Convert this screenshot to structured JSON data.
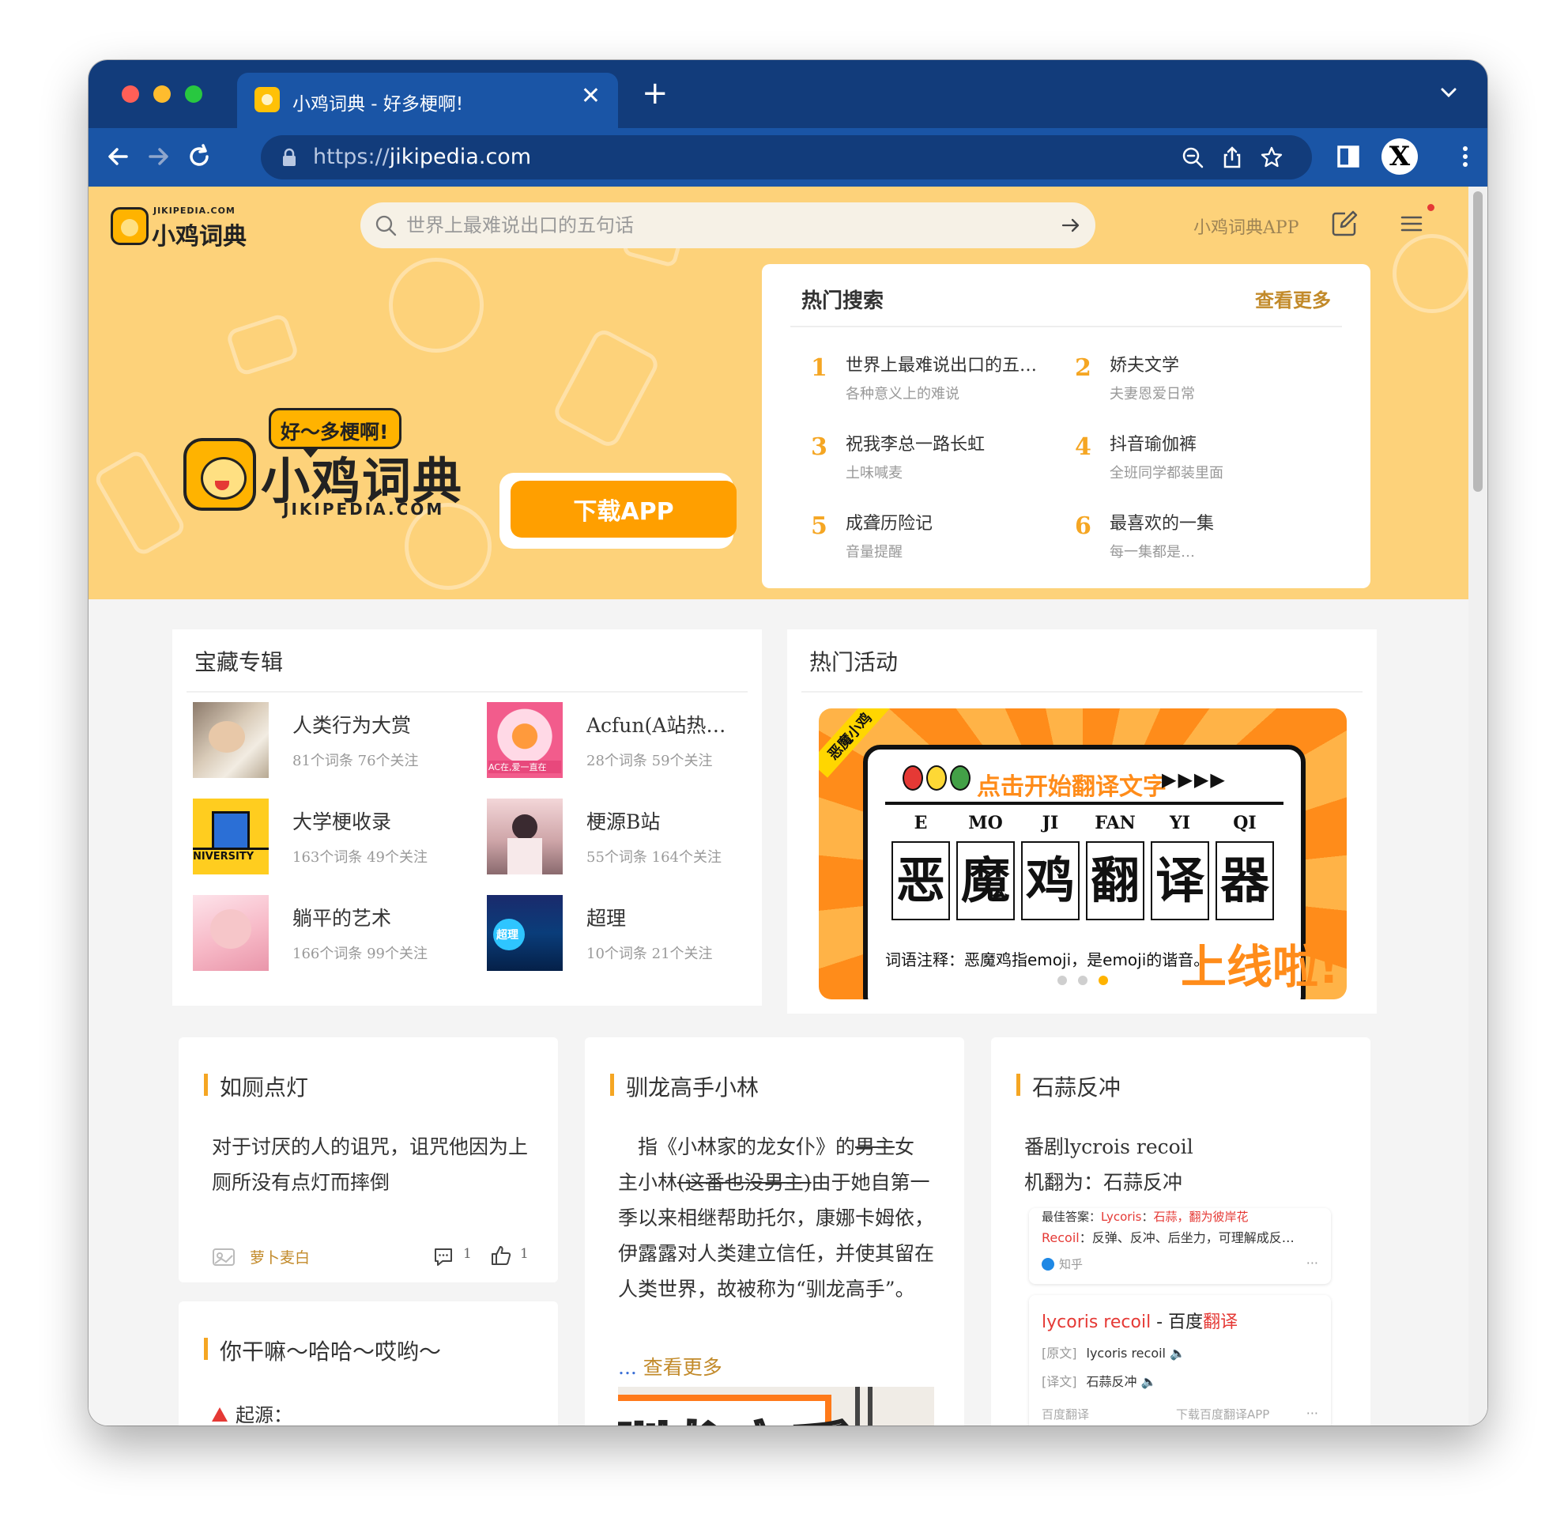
{
  "browser": {
    "tab_title": "小鸡词典 - 好多梗啊!",
    "url_scheme": "https://",
    "url_host": "jikipedia.com"
  },
  "header": {
    "logo_small": "JIKIPEDIA.COM",
    "logo_name": "小鸡词典",
    "search_placeholder": "世界上最难说出口的五句话",
    "app_link": "小鸡词典APP"
  },
  "hero": {
    "tagline": "好～多梗啊!",
    "brand_name": "小鸡词典",
    "brand_domain": "JIKIPEDIA.COM",
    "download_label": "下载APP"
  },
  "hot_search": {
    "title": "热门搜索",
    "more": "查看更多",
    "items": [
      {
        "rank": "1",
        "name": "世界上最难说出口的五…",
        "sub": "各种意义上的难说"
      },
      {
        "rank": "2",
        "name": "娇夫文学",
        "sub": "夫妻恩爱日常"
      },
      {
        "rank": "3",
        "name": "祝我李总一路长虹",
        "sub": "土味喊麦"
      },
      {
        "rank": "4",
        "name": "抖音瑜伽裤",
        "sub": "全班同学都装里面"
      },
      {
        "rank": "5",
        "name": "成聋历险记",
        "sub": "音量提醒"
      },
      {
        "rank": "6",
        "name": "最喜欢的一集",
        "sub": "每一集都是…"
      }
    ]
  },
  "albums": {
    "title": "宝藏专辑",
    "items": [
      {
        "name": "人类行为大赏",
        "meta": "81个词条  76个关注"
      },
      {
        "name": "Acfun(A站热…",
        "meta": "28个词条  59个关注"
      },
      {
        "name": "大学梗收录",
        "meta": "163个词条  49个关注"
      },
      {
        "name": "梗源B站",
        "meta": "55个词条  164个关注"
      },
      {
        "name": "躺平的艺术",
        "meta": "166个词条  99个关注"
      },
      {
        "name": "超理",
        "meta": "10个词条  21个关注"
      }
    ],
    "thumb_texts": {
      "acfun": "AC在,爱一直在",
      "university": "NIVERSITY",
      "chaoli": "超理"
    }
  },
  "events": {
    "title": "热门活动",
    "banner": {
      "strip": "恶魔小鸡",
      "head": "点击开始翻译文字",
      "arrows": "▶▶▶▶",
      "pinyin": [
        "E",
        "MO",
        "JI",
        "FAN",
        "YI",
        "QI"
      ],
      "hanzi": [
        "恶",
        "魔",
        "鸡",
        "翻",
        "译",
        "器"
      ],
      "note": "词语注释：恶魔鸡指emoji，是emoji的谐音。",
      "live": "上线啦!"
    }
  },
  "words": [
    {
      "title": "如厕点灯",
      "body": "对于讨厌的人的诅咒，诅咒他因为上厕所没有点灯而摔倒",
      "author": "萝卜麦白",
      "comments": "1",
      "likes": "1"
    },
    {
      "title": "你干嘛～哈哈～哎哟～",
      "origin": "起源："
    },
    {
      "title": "驯龙高手小林",
      "body_1": "指《小林家的龙女仆》的",
      "body_strike_1": "男主",
      "body_2": "女主小林",
      "body_strike_2": "(这番也没男主)",
      "body_3": "由于她自第一季以来相继帮助托尔，康娜卡姆依，伊露露对人类建立信任，并使其留在人类世界，故被称为“驯龙高手”。",
      "more_dots": "...",
      "more": "查看更多",
      "image_text": "驯龙高手"
    },
    {
      "title": "石蒜反冲",
      "line1": "番剧lycrois recoil",
      "line2": "机翻为：石蒜反冲",
      "zhihu": {
        "best_label": "最佳答案：",
        "best_red_1": "Lycoris",
        "best_mid": "：",
        "best_red_2": "石蒜，翻为彼岸花",
        "recoil_red": "Recoil",
        "recoil_text": "：反弹、反冲、后坐力，可理解成反…",
        "source": "知乎",
        "more": "···"
      },
      "baidu": {
        "title_red": "lycoris recoil",
        "title_mid": " - 百度",
        "title_red2": "翻译",
        "orig_label": "[原文]",
        "orig_text": "lycoris recoil",
        "trans_label": "[译文]",
        "trans_text": "石蒜反冲",
        "foot_left": "百度翻译",
        "foot_right": "下载百度翻译APP",
        "more": "···"
      }
    }
  ]
}
